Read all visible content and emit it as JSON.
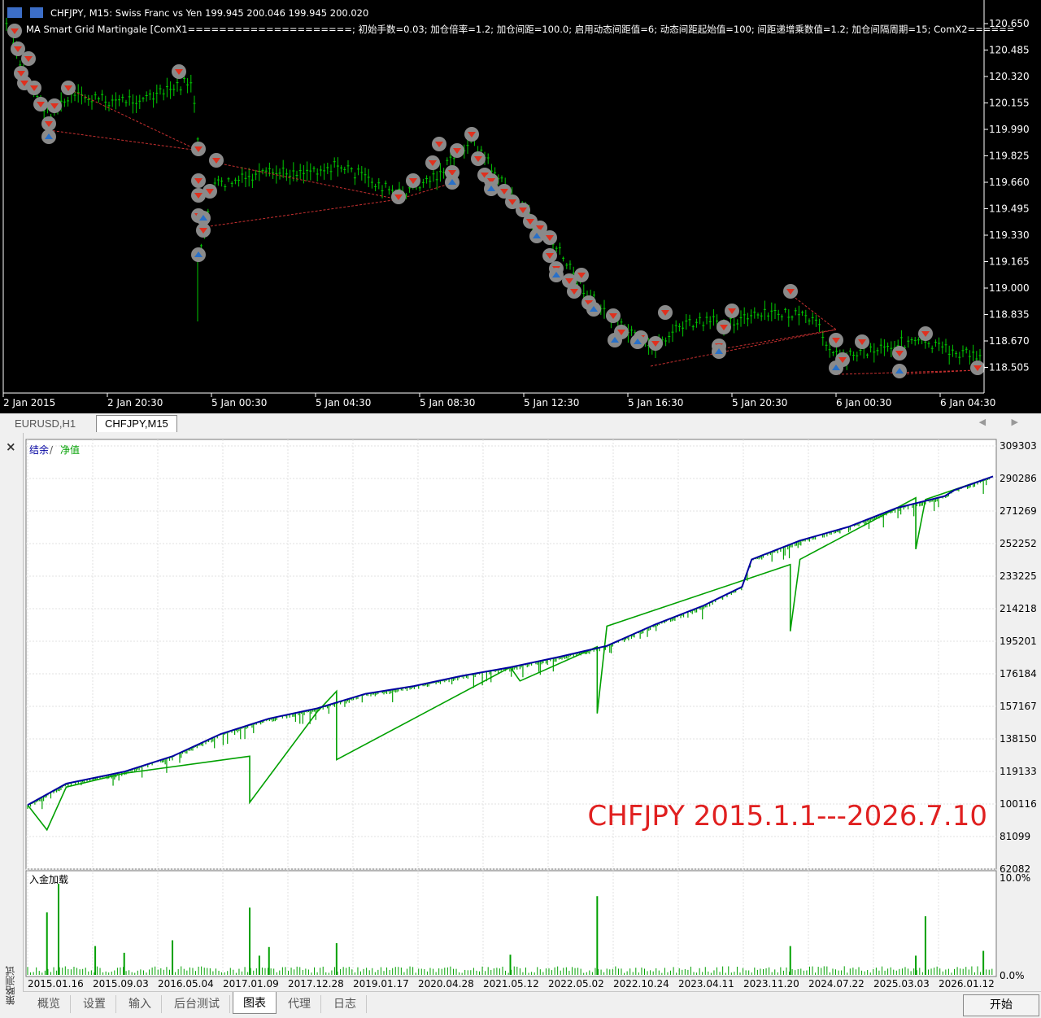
{
  "price_chart": {
    "title": "CHFJPY, M15:  Swiss Franc vs Yen  199.945 200.046 199.945 200.020",
    "indicator_text": "MA Smart Grid Martingale [ComX1=====================; 初始手数=0.03; 加仓倍率=1.2; 加仓间距=100.0; 启用动态间距值=6; 动态间距起始值=100; 间距递增乘数值=1.2; 加仓间隔周期=15; ComX2======",
    "y_ticks": [
      "120.650",
      "120.485",
      "120.320",
      "120.155",
      "119.990",
      "119.825",
      "119.660",
      "119.495",
      "119.330",
      "119.165",
      "119.000",
      "118.835",
      "118.670",
      "118.505"
    ],
    "x_ticks": [
      "2 Jan 2015",
      "2 Jan 20:30",
      "5 Jan 00:30",
      "5 Jan 04:30",
      "5 Jan 08:30",
      "5 Jan 12:30",
      "5 Jan 16:30",
      "5 Jan 20:30",
      "6 Jan 00:30",
      "6 Jan 04:30"
    ],
    "colors": {
      "candle": "#00c800",
      "sell_marker": "#e0301e",
      "buy_marker": "#2870c8",
      "trade_line": "#c83030"
    }
  },
  "chart_tabs": [
    "EURUSD,H1",
    "CHFJPY,M15"
  ],
  "tab_arrows": "◀ ▶",
  "tester": {
    "close_icon": "×",
    "side_label": "策略测试",
    "legend_balance": "结余",
    "legend_sep": " / ",
    "legend_equity": "净值",
    "overlay_label": "CHFJPY 2015.1.1---2026.7.10",
    "deposit_label": "入金加载",
    "deposit_top": "10.0%",
    "deposit_bottom": "0.0%",
    "colors": {
      "balance": "#0000a0",
      "equity": "#00a000",
      "overlay": "#e02020"
    }
  },
  "chart_data": [
    {
      "type": "line",
      "title": "",
      "xlabel": "",
      "ylabel": "",
      "x_ticks": [
        "2015.01.16",
        "2015.09.03",
        "2016.05.04",
        "2017.01.09",
        "2017.12.28",
        "2019.01.17",
        "2020.04.28",
        "2021.05.12",
        "2022.05.02",
        "2022.10.24",
        "2023.04.11",
        "2023.11.20",
        "2024.07.22",
        "2025.03.03",
        "2026.01.12"
      ],
      "y_ticks": [
        309303,
        290286,
        271269,
        252252,
        233225,
        214218,
        195201,
        176184,
        157167,
        138150,
        119133,
        100116,
        81099,
        62082
      ],
      "ylim": [
        62082,
        309303
      ],
      "legend": "top-left",
      "grid": true,
      "series": [
        {
          "name": "结余",
          "x": [
            0,
            0.04,
            0.1,
            0.15,
            0.2,
            0.25,
            0.3,
            0.35,
            0.4,
            0.45,
            0.5,
            0.55,
            0.6,
            0.65,
            0.7,
            0.74,
            0.75,
            0.8,
            0.85,
            0.9,
            0.95,
            0.96,
            1.0
          ],
          "values": [
            99500,
            112000,
            119000,
            128000,
            141000,
            150000,
            156000,
            164500,
            169000,
            175000,
            180000,
            186000,
            192500,
            205000,
            216000,
            227000,
            243000,
            254000,
            262000,
            273000,
            280000,
            283500,
            291500
          ]
        },
        {
          "name": "净值",
          "x": [
            0,
            0.02,
            0.04,
            0.1,
            0.23,
            0.23,
            0.3,
            0.32,
            0.32,
            0.5,
            0.51,
            0.59,
            0.59,
            0.6,
            0.79,
            0.79,
            0.8,
            0.92,
            0.92,
            0.93,
            1.0
          ],
          "values": [
            99500,
            85000,
            110000,
            118000,
            128000,
            101000,
            154000,
            166000,
            126000,
            180000,
            172000,
            192000,
            153000,
            204000,
            240000,
            201000,
            243000,
            279000,
            249000,
            278000,
            291500
          ]
        }
      ]
    },
    {
      "type": "bar",
      "title": "入金加载",
      "ylim": [
        0,
        10
      ],
      "y_unit": "%",
      "spikes": [
        {
          "x": 0.02,
          "value": 6.5
        },
        {
          "x": 0.032,
          "value": 9.5
        },
        {
          "x": 0.07,
          "value": 3.0
        },
        {
          "x": 0.1,
          "value": 2.3
        },
        {
          "x": 0.15,
          "value": 3.6
        },
        {
          "x": 0.23,
          "value": 7.0
        },
        {
          "x": 0.24,
          "value": 2.0
        },
        {
          "x": 0.25,
          "value": 2.9
        },
        {
          "x": 0.32,
          "value": 3.3
        },
        {
          "x": 0.5,
          "value": 2.1
        },
        {
          "x": 0.59,
          "value": 8.2
        },
        {
          "x": 0.79,
          "value": 3.0
        },
        {
          "x": 0.92,
          "value": 2.0
        },
        {
          "x": 0.93,
          "value": 6.1
        },
        {
          "x": 0.99,
          "value": 2.5
        }
      ]
    }
  ],
  "bottom_tabs": [
    "概览",
    "设置",
    "输入",
    "后台测试",
    "图表",
    "代理",
    "日志"
  ],
  "active_bottom_tab": "图表",
  "start_button": "开始"
}
